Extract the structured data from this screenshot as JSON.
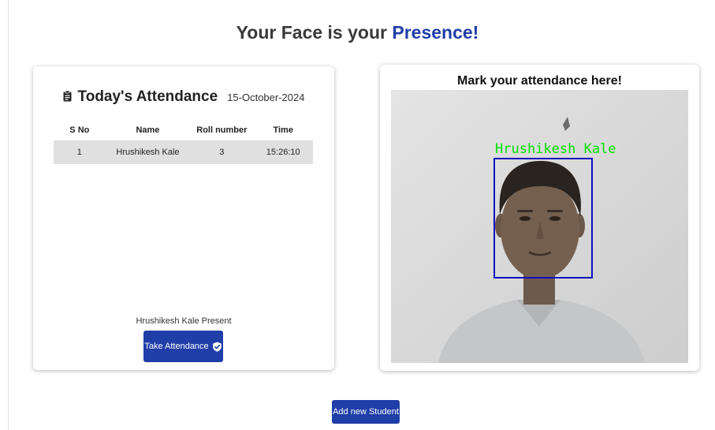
{
  "page": {
    "title_prefix": "Your Face is your",
    "title_accent": "Presence!",
    "accent_color": "#1f3ea8"
  },
  "attendance": {
    "title": "Today's Attendance",
    "date": "15-October-2024",
    "icon": "clipboard-icon",
    "columns": [
      "S No",
      "Name",
      "Roll number",
      "Time"
    ],
    "rows": [
      [
        "1",
        "Hrushikesh Kale",
        "3",
        "15:26:10"
      ]
    ],
    "status": "Hrushikesh Kale Present",
    "take_button": "Take Attendance",
    "take_button_icon": "check-badge-icon"
  },
  "camera": {
    "title": "Mark your attendance here!",
    "detected_name": "Hrushikesh Kale",
    "label_color": "#00e000",
    "box_color": "#1010c0"
  },
  "footer": {
    "add_student_button": "Add new Student"
  }
}
